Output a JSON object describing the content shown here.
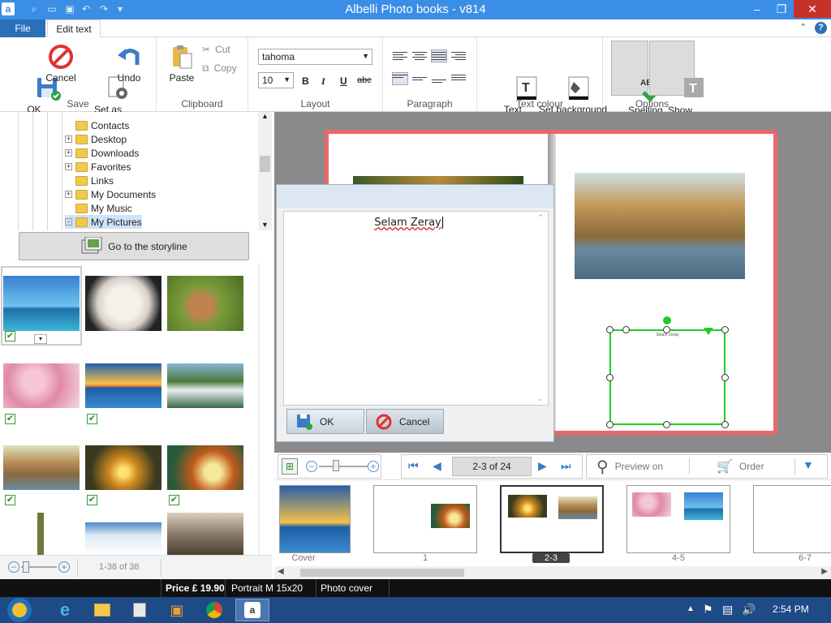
{
  "window": {
    "title": "Albelli Photo books - v814"
  },
  "tabs": [
    {
      "label": "File"
    },
    {
      "label": "Edit text"
    }
  ],
  "ribbon": {
    "save": {
      "label": "Save",
      "ok": "OK",
      "cancel": "Cancel",
      "set_default": "Set as\ndefault",
      "undo": "Undo"
    },
    "clipboard": {
      "label": "Clipboard",
      "paste": "Paste",
      "cut": "Cut",
      "copy": "Copy"
    },
    "layout": {
      "label": "Layout",
      "font": "tahoma",
      "size": "10",
      "bold": "B",
      "italic": "I",
      "underline": "U",
      "strike": "abc"
    },
    "paragraph": {
      "label": "Paragraph"
    },
    "text_colour": {
      "label": "Text colour",
      "text_colour": "Text\ncolour",
      "bg_colour": "Set background\ncolour"
    },
    "options": {
      "label": "Options",
      "spelling": "Spelling\ncheck",
      "white_text": "Show\nwhite text"
    }
  },
  "tree": {
    "items": [
      {
        "label": "Contacts",
        "expander": ""
      },
      {
        "label": "Desktop",
        "expander": "+"
      },
      {
        "label": "Downloads",
        "expander": "+"
      },
      {
        "label": "Favorites",
        "expander": "+"
      },
      {
        "label": "Links",
        "expander": ""
      },
      {
        "label": "My Documents",
        "expander": "+"
      },
      {
        "label": "My Music",
        "expander": ""
      },
      {
        "label": "My Pictures",
        "expander": "-"
      }
    ]
  },
  "goto_storyline": "Go to the storyline",
  "photos_count": "1-38 of 38",
  "dialog": {
    "text": "Selam Zeray",
    "ok": "OK",
    "cancel": "Cancel"
  },
  "page_text": "Selam Zeray",
  "nav": {
    "page_indicator": "2-3 of 24",
    "preview": "Preview on",
    "order": "Order"
  },
  "strip": {
    "pages": [
      {
        "label": "Cover"
      },
      {
        "label": "1"
      },
      {
        "label": "2-3"
      },
      {
        "label": "4-5"
      },
      {
        "label": "6-7"
      }
    ]
  },
  "status": {
    "price": "Price £ 19.90",
    "format": "Portrait M 15x20 cm",
    "cover": "Photo cover"
  },
  "taskbar": {
    "time": "2:54 PM"
  },
  "colors": {
    "accent": "#3a8ee6",
    "file_tab": "#2b6fb8",
    "spread_bg": "#e8676b",
    "selection": "#22cc22"
  }
}
